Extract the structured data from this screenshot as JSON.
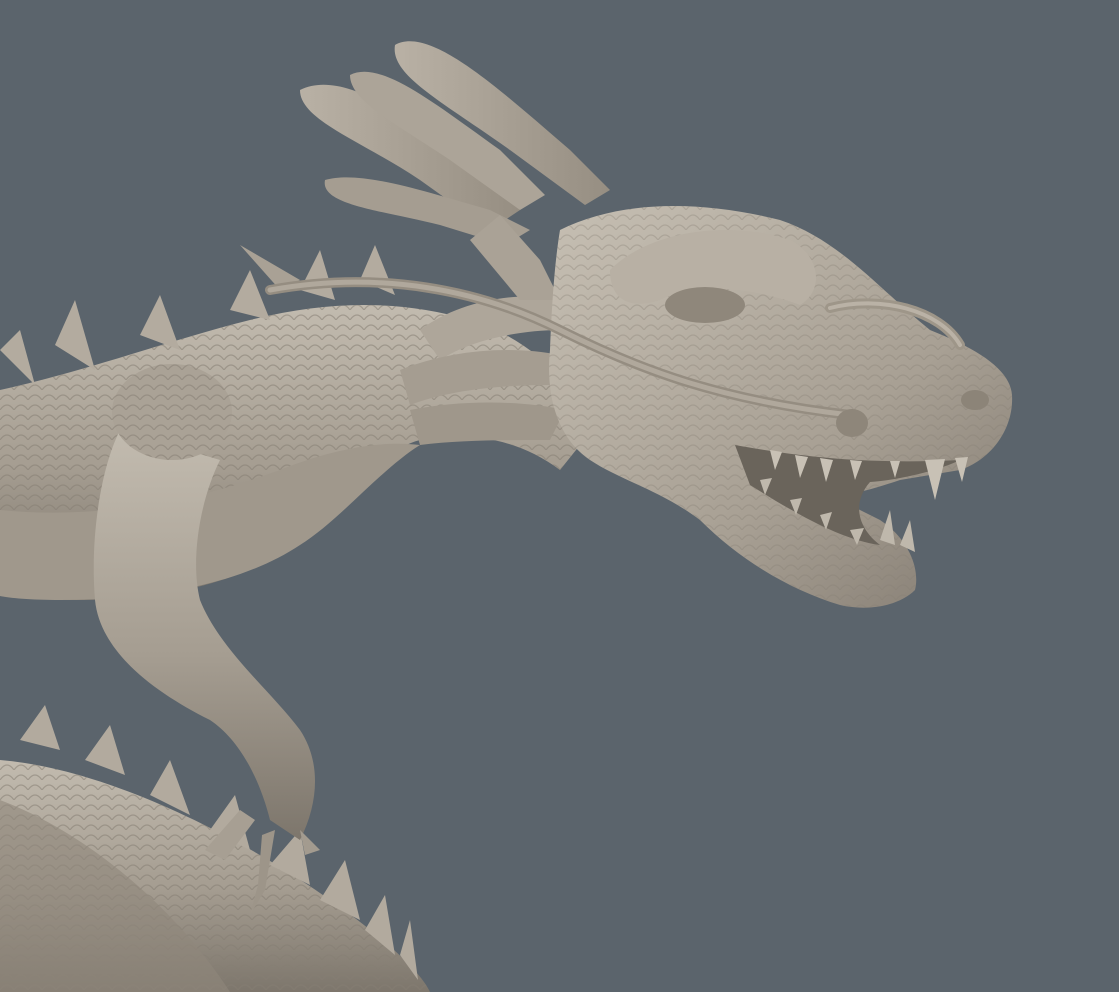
{
  "viewport": {
    "background_color": "#5b646c"
  },
  "model": {
    "subject": "dragon-sculpt",
    "base_color": "#a49c90",
    "highlight_color": "#c7c0b4",
    "shadow_color": "#6f6960"
  }
}
